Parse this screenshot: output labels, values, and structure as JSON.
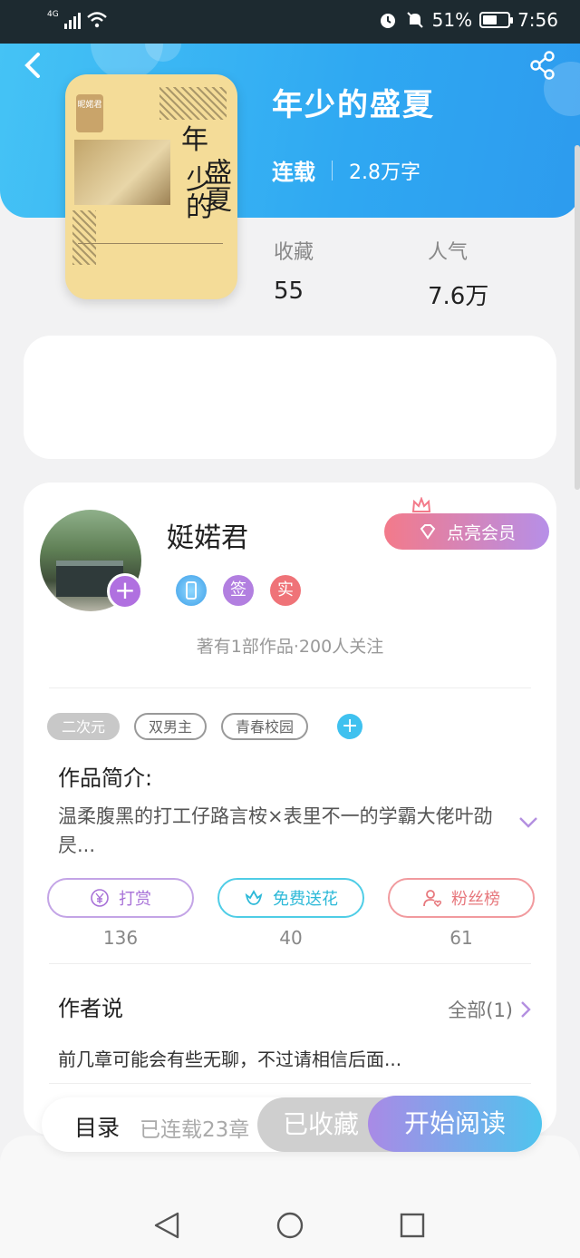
{
  "status_bar": {
    "network": "4G",
    "battery": "51%",
    "time": "7:56"
  },
  "book": {
    "title": "年少的盛夏",
    "status": "连载",
    "word_count": "2.8万字",
    "cover": {
      "publisher_mark": "昵婼君",
      "line1": "年",
      "line2": "盛夏",
      "line3": "少的"
    },
    "stats": [
      {
        "label": "收藏",
        "value": "55"
      },
      {
        "label": "人气",
        "value": "7.6万"
      }
    ]
  },
  "author": {
    "name": "娗婼君",
    "vip_label": "点亮会员",
    "badges": {
      "sign": "签",
      "real": "实"
    },
    "works_summary": "著有1部作品·200人关注"
  },
  "tags": [
    "二次元",
    "双男主",
    "青春校园"
  ],
  "intro": {
    "heading": "作品简介:",
    "text": "温柔腹黑的打工仔路言桉×表里不一的学霸大佬叶劭昃..."
  },
  "actions": [
    {
      "label": "打赏",
      "count": "136"
    },
    {
      "label": "免费送花",
      "count": "40"
    },
    {
      "label": "粉丝榜",
      "count": "61"
    }
  ],
  "author_says": {
    "heading": "作者说",
    "more": "全部(1)",
    "text": "前几章可能会有些无聊，不过请相信后面..."
  },
  "bottom_bar": {
    "toc": "目录",
    "chapters": "已连载23章",
    "favorited": "已收藏",
    "start_reading": "开始阅读"
  },
  "colors": {
    "header_blue": "#2fa8f2",
    "accent_purple": "#b070e0",
    "accent_cyan": "#3fc1ef",
    "accent_pink": "#ef7378"
  }
}
